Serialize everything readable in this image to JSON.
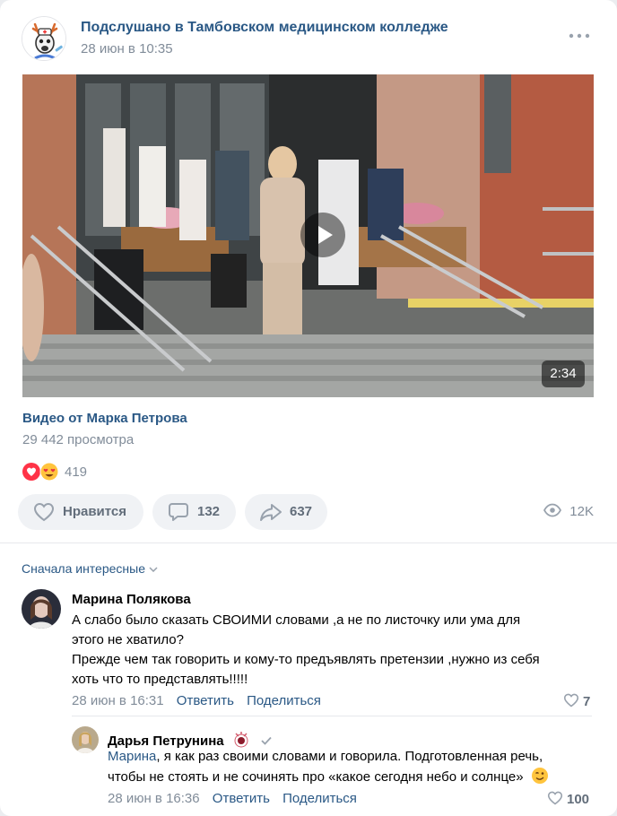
{
  "post": {
    "group_name": "Подслушано в Тамбовском медицинском колледже",
    "date": "28 июн в 10:35"
  },
  "video": {
    "duration": "2:34",
    "title": "Видео от Марка Петрова",
    "views": "29 442 просмотра"
  },
  "reactions": {
    "count": "419"
  },
  "actions": {
    "like_label": "Нравится",
    "comments_count": "132",
    "shares_count": "637",
    "views_count": "12K"
  },
  "comments_sort": "Сначала интересные",
  "comments": [
    {
      "author": "Марина Полякова",
      "text_lines": [
        "А слабо было сказать СВОИМИ словами ,а не по листочку или ума для",
        "этого не хватило?",
        "Прежде чем так говорить и кому-то предъявлять претензии ,нужно из себя",
        "хоть что то представлять!!!!!"
      ],
      "date": "28 июн в 16:31",
      "reply_label": "Ответить",
      "share_label": "Поделиться",
      "likes": "7"
    },
    {
      "author": "Дарья Петрунина",
      "mention": "Марина",
      "text_lines": [
        ", я как раз своими словами и говорила. Подготовленная речь,",
        "чтобы не стоять и не сочинять про «какое сегодня небо и солнце»"
      ],
      "date": "28 июн в 16:36",
      "reply_label": "Ответить",
      "share_label": "Поделиться",
      "likes": "100"
    }
  ],
  "colors": {
    "link": "#2a5885",
    "secondary": "#818c99",
    "button_bg": "#f0f2f5",
    "reaction_red": "#ff3347"
  }
}
